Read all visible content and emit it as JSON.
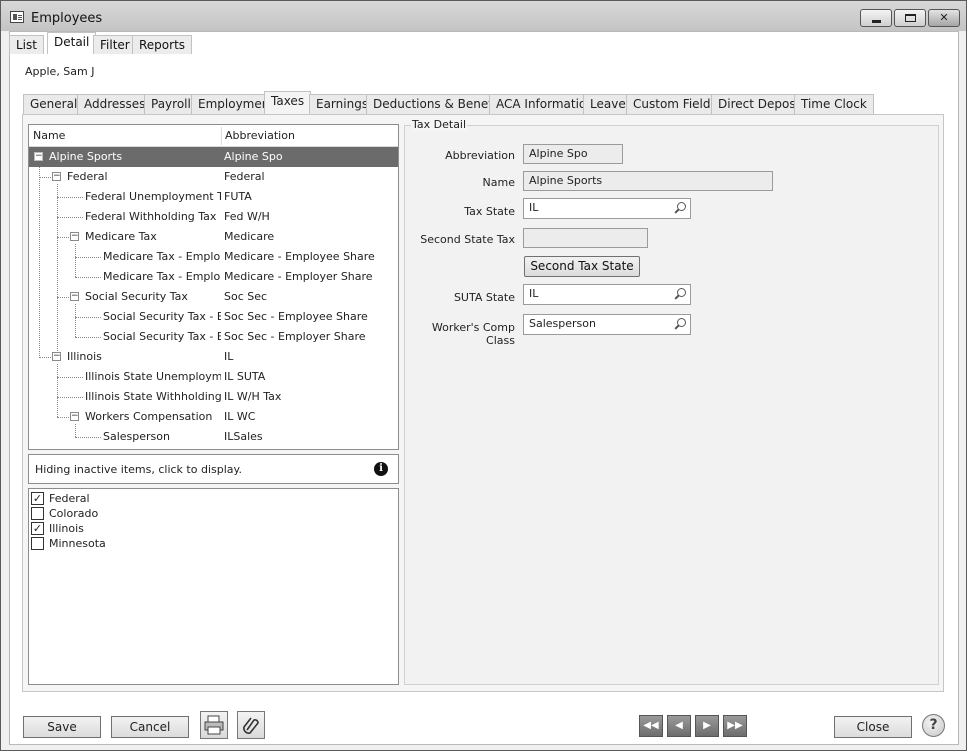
{
  "window": {
    "title": "Employees"
  },
  "top_tabs": [
    "List",
    "Detail",
    "Filter",
    "Reports"
  ],
  "employee_name": "Apple, Sam J",
  "sub_tabs": [
    "General",
    "Addresses",
    "Payroll",
    "Employment",
    "Taxes",
    "Earnings",
    "Deductions & Benefits",
    "ACA Information",
    "Leave",
    "Custom Fields",
    "Direct Deposit",
    "Time Clock"
  ],
  "tree": {
    "headers": {
      "name": "Name",
      "abbreviation": "Abbreviation"
    },
    "rows": [
      {
        "name": "Alpine Sports",
        "abbr": "Alpine Spo"
      },
      {
        "name": "Federal",
        "abbr": "Federal"
      },
      {
        "name": "Federal Unemployment Tax",
        "abbr": "FUTA"
      },
      {
        "name": "Federal Withholding Tax",
        "abbr": "Fed W/H"
      },
      {
        "name": "Medicare Tax",
        "abbr": "Medicare"
      },
      {
        "name": "Medicare Tax - Emplo...",
        "abbr": "Medicare - Employee Share"
      },
      {
        "name": "Medicare Tax - Emplo...",
        "abbr": "Medicare - Employer Share"
      },
      {
        "name": "Social Security Tax",
        "abbr": "Soc Sec"
      },
      {
        "name": "Social Security Tax - E...",
        "abbr": "Soc Sec - Employee Share"
      },
      {
        "name": "Social Security Tax - E...",
        "abbr": "Soc Sec - Employer Share"
      },
      {
        "name": "Illinois",
        "abbr": "IL"
      },
      {
        "name": "Illinois State Unemployme...",
        "abbr": "IL SUTA"
      },
      {
        "name": "Illinois State Withholding ...",
        "abbr": "IL W/H Tax"
      },
      {
        "name": "Workers Compensation",
        "abbr": "IL WC"
      },
      {
        "name": "Salesperson",
        "abbr": "ILSales"
      }
    ]
  },
  "inactive_info": "Hiding inactive items, click to display.",
  "states": [
    {
      "label": "Federal",
      "mark": "✓"
    },
    {
      "label": "Colorado",
      "mark": ""
    },
    {
      "label": "Illinois",
      "mark": "✓"
    },
    {
      "label": "Minnesota",
      "mark": ""
    }
  ],
  "tax_detail": {
    "legend": "Tax Detail",
    "abbreviation_label": "Abbreviation",
    "abbreviation_value": "Alpine Spo",
    "name_label": "Name",
    "name_value": "Alpine Sports",
    "tax_state_label": "Tax State",
    "tax_state_value": "IL",
    "second_state_label": "Second State Tax",
    "second_state_value": "",
    "second_state_button": "Second Tax State",
    "suta_state_label": "SUTA State",
    "suta_state_value": "IL",
    "workers_comp_label": "Worker's Comp Class",
    "workers_comp_value": "Salesperson"
  },
  "footer": {
    "save": "Save",
    "cancel": "Cancel",
    "close": "Close",
    "help": "?"
  }
}
